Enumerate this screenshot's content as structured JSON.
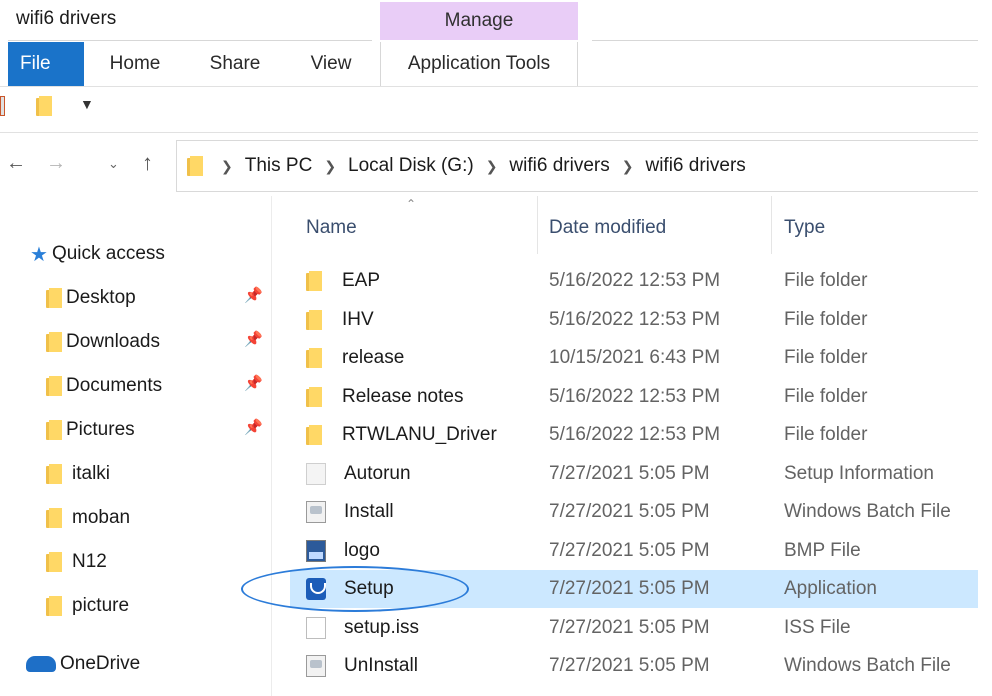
{
  "window": {
    "title": "wifi6 drivers"
  },
  "ribbon": {
    "context_group": "Manage",
    "tabs": [
      {
        "label": "File"
      },
      {
        "label": "Home"
      },
      {
        "label": "Share"
      },
      {
        "label": "View"
      },
      {
        "label": "Application Tools"
      }
    ]
  },
  "address_bar": {
    "crumbs": [
      "This PC",
      "Local Disk (G:)",
      "wifi6 drivers",
      "wifi6 drivers"
    ]
  },
  "sidebar": {
    "items": [
      {
        "label": "Quick access",
        "icon": "star-icon",
        "pinned": false
      },
      {
        "label": "Desktop",
        "icon": "desktop-folder-icon",
        "pinned": true
      },
      {
        "label": "Downloads",
        "icon": "downloads-folder-icon",
        "pinned": true
      },
      {
        "label": "Documents",
        "icon": "documents-folder-icon",
        "pinned": true
      },
      {
        "label": "Pictures",
        "icon": "pictures-folder-icon",
        "pinned": true
      },
      {
        "label": "italki",
        "icon": "folder-icon",
        "pinned": false
      },
      {
        "label": "moban",
        "icon": "folder-icon",
        "pinned": false
      },
      {
        "label": "N12",
        "icon": "folder-icon",
        "pinned": false
      },
      {
        "label": "picture",
        "icon": "folder-icon",
        "pinned": false
      },
      {
        "label": "OneDrive",
        "icon": "cloud-icon",
        "pinned": false
      }
    ]
  },
  "columns": {
    "name": "Name",
    "date": "Date modified",
    "type": "Type"
  },
  "files": [
    {
      "name": "EAP",
      "date": "5/16/2022 12:53 PM",
      "type": "File folder",
      "icon": "folder"
    },
    {
      "name": "IHV",
      "date": "5/16/2022 12:53 PM",
      "type": "File folder",
      "icon": "folder"
    },
    {
      "name": "release",
      "date": "10/15/2021 6:43 PM",
      "type": "File folder",
      "icon": "folder"
    },
    {
      "name": "Release notes",
      "date": "5/16/2022 12:53 PM",
      "type": "File folder",
      "icon": "folder"
    },
    {
      "name": "RTWLANU_Driver",
      "date": "5/16/2022 12:53 PM",
      "type": "File folder",
      "icon": "folder"
    },
    {
      "name": "Autorun",
      "date": "7/27/2021 5:05 PM",
      "type": "Setup Information",
      "icon": "setupinf"
    },
    {
      "name": "Install",
      "date": "7/27/2021 5:05 PM",
      "type": "Windows Batch File",
      "icon": "bat"
    },
    {
      "name": "logo",
      "date": "7/27/2021 5:05 PM",
      "type": "BMP File",
      "icon": "bmp"
    },
    {
      "name": "Setup",
      "date": "7/27/2021 5:05 PM",
      "type": "Application",
      "icon": "app",
      "selected": true
    },
    {
      "name": "setup.iss",
      "date": "7/27/2021 5:05 PM",
      "type": "ISS File",
      "icon": "blank"
    },
    {
      "name": "UnInstall",
      "date": "7/27/2021 5:05 PM",
      "type": "Windows Batch File",
      "icon": "bat"
    }
  ]
}
